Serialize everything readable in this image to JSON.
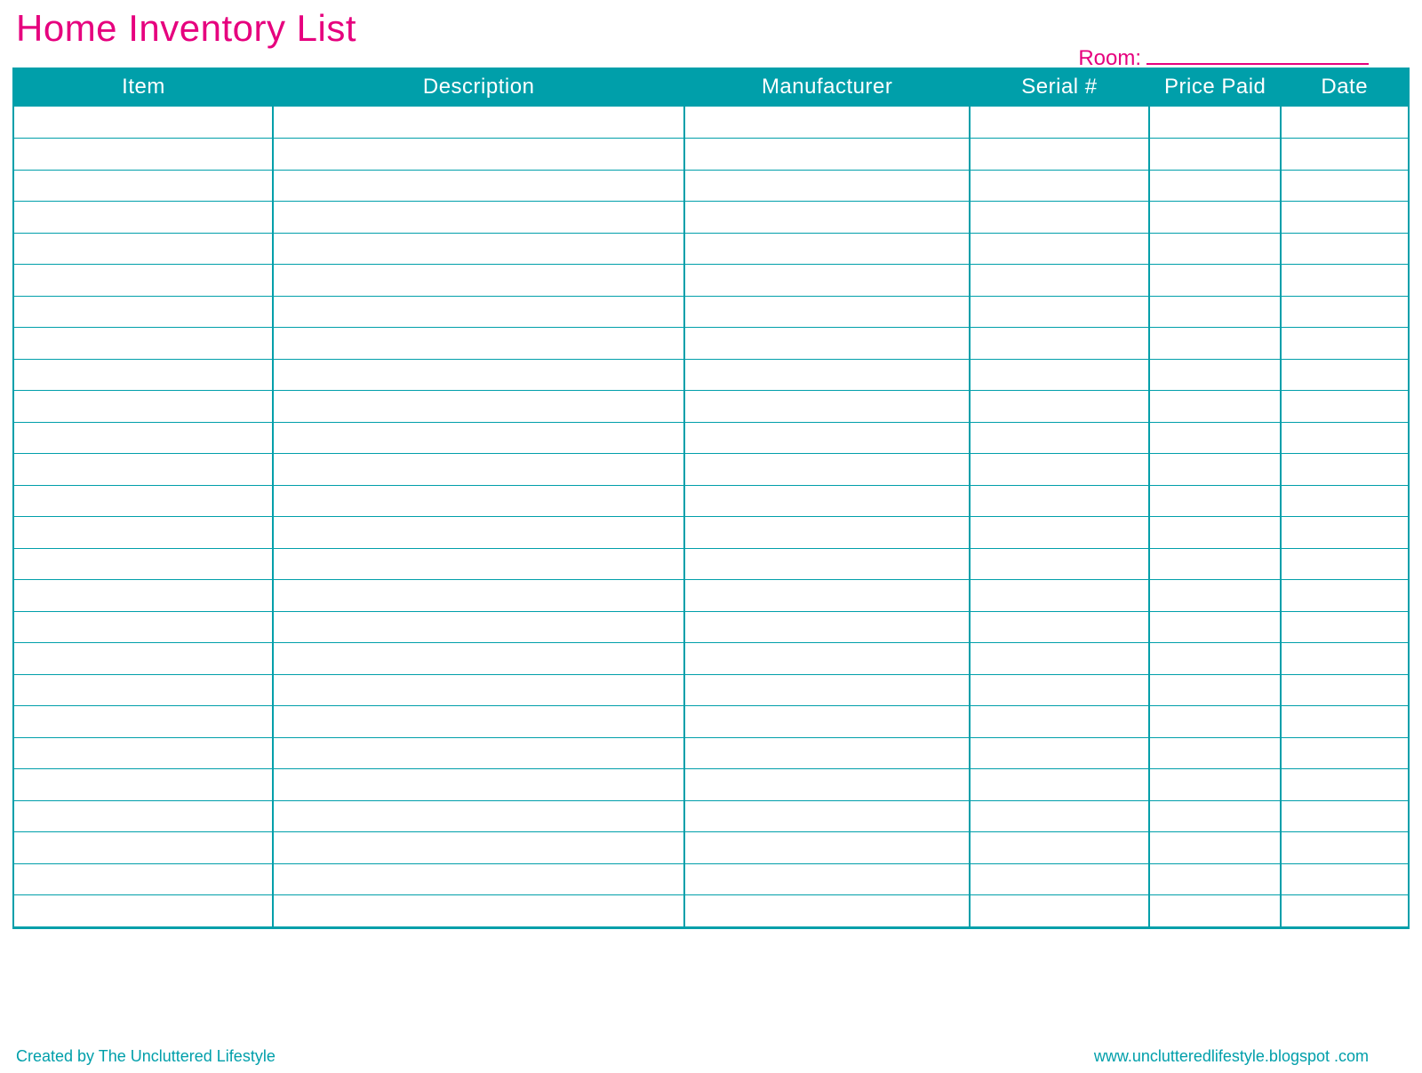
{
  "header": {
    "title": "Home Inventory List",
    "room_label": "Room:"
  },
  "columns": {
    "item": "Item",
    "description": "Description",
    "manufacturer": "Manufacturer",
    "serial": "Serial #",
    "price": "Price Paid",
    "date": "Date"
  },
  "row_count": 26,
  "footer": {
    "left": "Created by The Uncluttered Lifestyle",
    "right": "www.unclutteredlifestyle.blogspot .com"
  },
  "colors": {
    "accent_pink": "#e6007e",
    "accent_teal": "#009faa"
  }
}
